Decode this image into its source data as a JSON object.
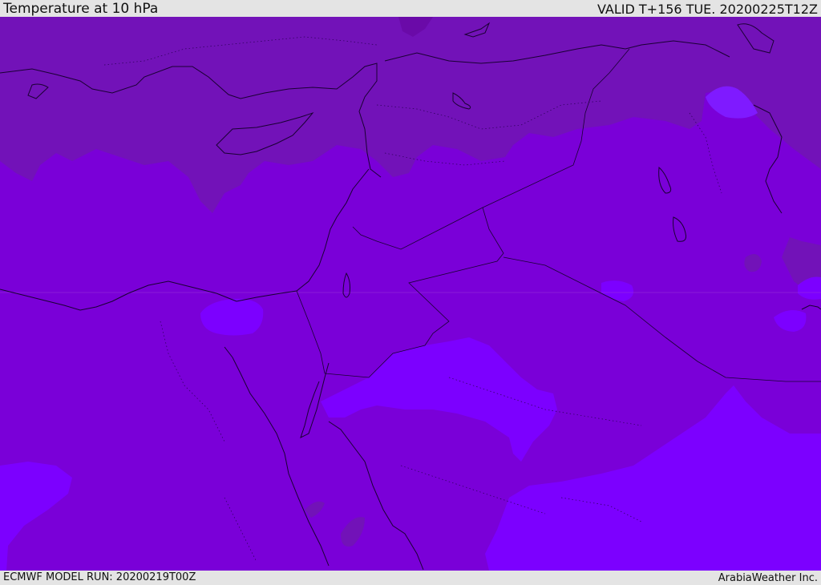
{
  "header": {
    "title": "Temperature at 10 hPa",
    "valid": "VALID T+156 TUE. 20200225T12Z"
  },
  "footer": {
    "model_run": "ECMWF MODEL RUN: 20200219T00Z",
    "credit": "ArabiaWeather Inc."
  },
  "map": {
    "field": "temperature",
    "level": "10 hPa",
    "colors": {
      "band_dark": "#7212b8",
      "band_mid": "#7a00d8",
      "band_light": "#7c00ff",
      "band_lightest": "#7f1aff",
      "coastline": "#1a0033",
      "grid": "#9a3ad8"
    }
  }
}
